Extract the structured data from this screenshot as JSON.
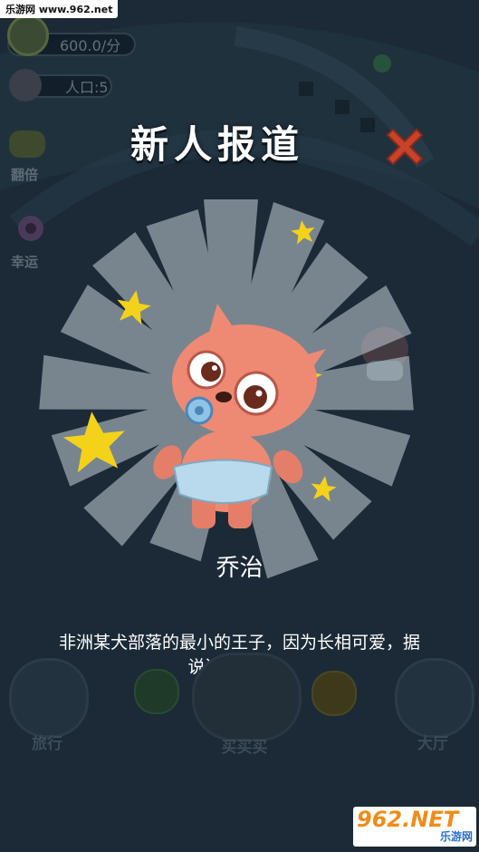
{
  "watermark_top": "乐游网 www.962.net",
  "hud": {
    "income_rate": "600.0/分",
    "population": "人口:5"
  },
  "side_menu": [
    {
      "label": "翻倍",
      "icon": "paw-coins-icon"
    },
    {
      "label": "幸运",
      "icon": "lucky-gear-icon"
    }
  ],
  "popup": {
    "title": "新人报道",
    "character_name": "乔治",
    "character_description": "非洲某犬部落的最小的王子，因为长相可爱，据说还是网红！"
  },
  "bottom_nav": [
    {
      "label": "旅行",
      "icon": "anchor-icon"
    },
    {
      "label": "买买买",
      "icon": "shop-icon"
    },
    {
      "label": "大厅",
      "icon": "ship-icon"
    }
  ],
  "watermark_bottom": {
    "main": "962.NET",
    "sub": "乐游网"
  },
  "colors": {
    "background": "#1b2a36",
    "close_red": "#c9422a",
    "star_yellow": "#f4d21a",
    "character_pink": "#ee8a74"
  }
}
